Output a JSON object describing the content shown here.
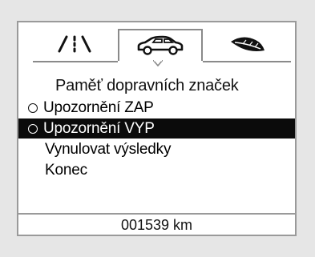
{
  "tabs": {
    "items": [
      {
        "icon": "lane-assist-icon"
      },
      {
        "icon": "car-icon",
        "active": true
      },
      {
        "icon": "eco-leaf-icon"
      }
    ]
  },
  "menu": {
    "title": "Paměť dopravních značek",
    "items": [
      {
        "label": "Upozornění ZAP",
        "radio": true,
        "selected": false
      },
      {
        "label": "Upozornění VYP",
        "radio": true,
        "selected": true
      },
      {
        "label": "Vynulovat výsledky",
        "radio": false,
        "selected": false
      },
      {
        "label": "Konec",
        "radio": false,
        "selected": false
      }
    ]
  },
  "footer": {
    "odometer": "001539 km"
  },
  "colors": {
    "background": "#e6e6e6",
    "screen": "#ffffff",
    "highlight": "#0b0b0b",
    "border": "#9a9a9a"
  }
}
